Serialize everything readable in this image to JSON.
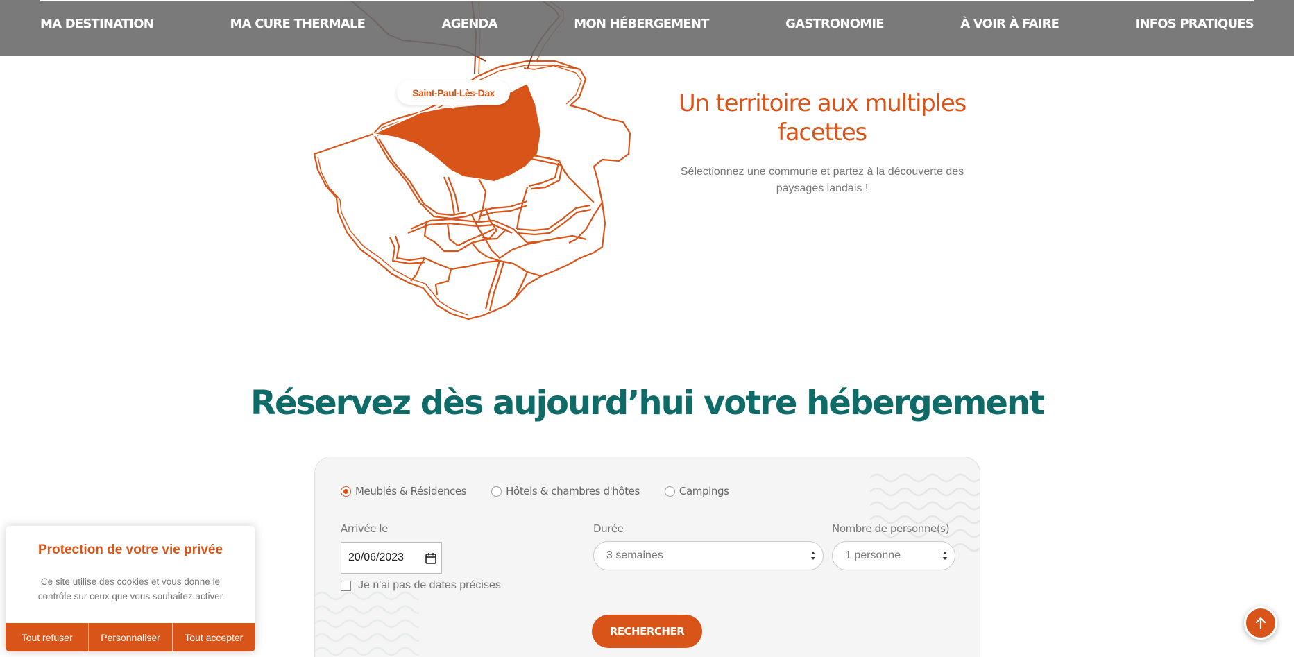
{
  "colors": {
    "accent": "#d85418",
    "teal": "#0f6b68",
    "nav_bg": "#6c6c6c",
    "text_muted": "#777777"
  },
  "nav": {
    "items": [
      {
        "label": "MA DESTINATION"
      },
      {
        "label": "MA CURE THERMALE"
      },
      {
        "label": "AGENDA"
      },
      {
        "label": "MON HÉBERGEMENT"
      },
      {
        "label": "GASTRONOMIE"
      },
      {
        "label": "À VOIR À FAIRE"
      },
      {
        "label": "INFOS PRATIQUES"
      }
    ]
  },
  "map": {
    "tooltip": "Saint-Paul-Lès-Dax"
  },
  "territory": {
    "title": "Un territoire aux multiples facettes",
    "description": "Sélectionnez une commune et partez à la découverte des paysages landais !"
  },
  "booking": {
    "title": "Réservez dès aujourd’hui votre hébergement",
    "types": [
      {
        "label": "Meublés & Résidences",
        "checked": true
      },
      {
        "label": "Hôtels & chambres d'hôtes",
        "checked": false
      },
      {
        "label": "Campings",
        "checked": false
      }
    ],
    "arrival_label": "Arrivée le",
    "arrival_value": "20/06/2023",
    "no_dates_label": "Je n'ai pas de dates précises",
    "duration_label": "Durée",
    "duration_value": "3 semaines",
    "persons_label": "Nombre de personne(s)",
    "persons_value": "1 personne",
    "search_label": "RECHERCHER"
  },
  "cookie": {
    "title": "Protection de votre vie privée",
    "text": "Ce site utilise des cookies et vous donne le contrôle sur ceux que vous souhaitez activer",
    "refuse": "Tout refuser",
    "customize": "Personnaliser",
    "accept": "Tout accepter"
  },
  "icons": {
    "calendar": "calendar-icon",
    "arrow_up": "arrow-up-icon"
  }
}
